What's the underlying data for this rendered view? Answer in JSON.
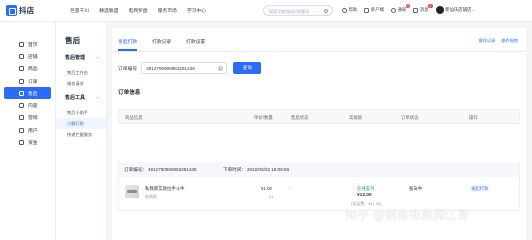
{
  "app": {
    "logo_text": "抖店"
  },
  "topnav": [
    "巨量千川",
    "精选联盟",
    "电商罗盘",
    "服务市场",
    "学习中心"
  ],
  "search": {
    "placeholder": "搜索功能/服务/关键词"
  },
  "top_right": {
    "help": "帮助",
    "customer_service": "客户端",
    "notice": "通知",
    "notice_badge": "9",
    "message": "消息",
    "message_badge": "1",
    "store_name": "新仙乐店铺店…"
  },
  "sidebar": {
    "items": [
      {
        "label": "首页",
        "icon": "home-icon"
      },
      {
        "label": "店铺",
        "icon": "shop-icon"
      },
      {
        "label": "商品",
        "icon": "goods-icon"
      },
      {
        "label": "订单",
        "icon": "order-icon"
      },
      {
        "label": "售后",
        "icon": "aftersale-icon",
        "active": true
      },
      {
        "label": "内容",
        "icon": "content-icon"
      },
      {
        "label": "营销",
        "icon": "marketing-icon"
      },
      {
        "label": "用户",
        "icon": "user-icon"
      },
      {
        "label": "资金",
        "icon": "finance-icon"
      }
    ]
  },
  "subnav": {
    "title": "售后",
    "group1": {
      "title": "售后管理",
      "items": [
        "售后工作台",
        "服务请求"
      ]
    },
    "group2": {
      "title": "售后工具",
      "items": [
        "售后小助手",
        "小额打款",
        "快递拦截服务"
      ]
    }
  },
  "tabs": {
    "items": [
      "发起打款",
      "打款记录",
      "打款设置"
    ],
    "links": [
      "操作记录",
      "操作指南"
    ]
  },
  "query": {
    "label": "订单编号",
    "value": "4912790906953291436",
    "button": "查询"
  },
  "section": {
    "title": "订单信息"
  },
  "table": {
    "headers": [
      "商品信息",
      "单价/数量",
      "售后状态",
      "实收款",
      "订单状态",
      "操作"
    ]
  },
  "order": {
    "id_label": "订单编号：",
    "id": "4912790906953291436",
    "time_label": "下单时间：",
    "time": "2022/03/22 18:06:56",
    "product_name": "私我厚实款拉手斗牛",
    "product_spec": "经典款",
    "unit_price": "¥1.00",
    "quantity": "x1",
    "aftersale_status": "-",
    "pay_method": "在线支付",
    "received": "¥12.00",
    "received_note": "(含运费：¥11.00)",
    "status": "备货中",
    "action": "发起打款"
  },
  "watermark": "知乎 @创客电商阎江哥"
}
